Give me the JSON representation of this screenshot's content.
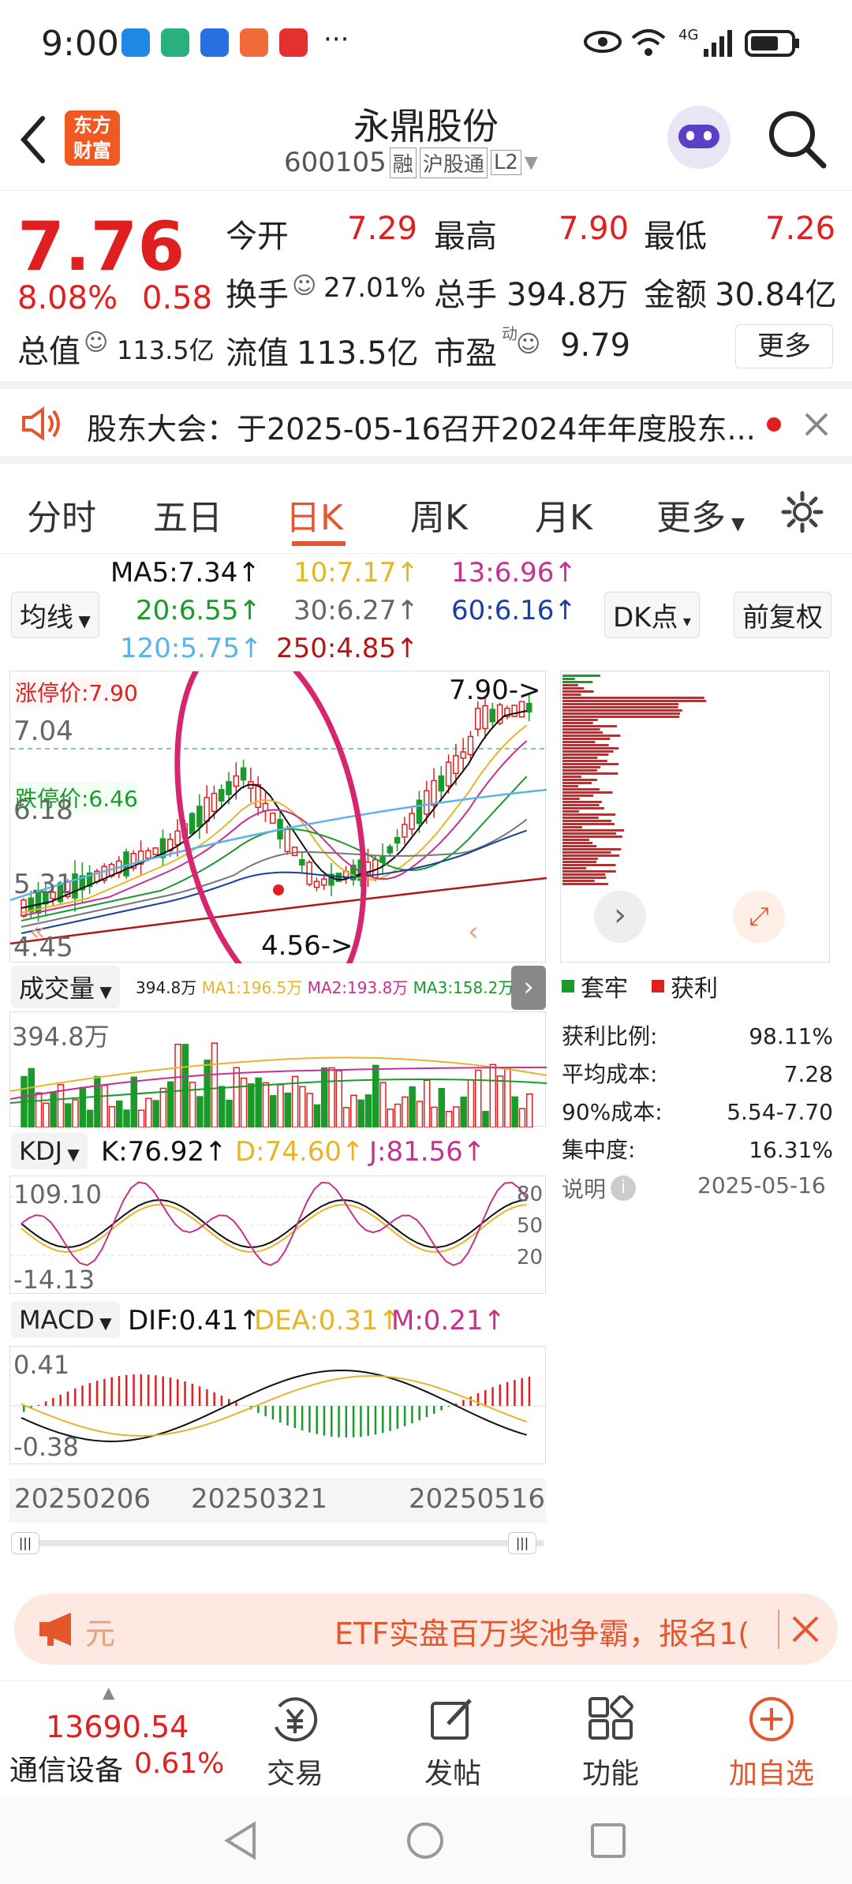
{
  "status": {
    "time": "9:00",
    "more": "···",
    "network": "4G"
  },
  "header": {
    "logo_line1": "东方",
    "logo_line2": "财富",
    "stock_name": "永鼎股份",
    "code": "600105",
    "tag_margin": "融",
    "tag_connect": "沪股通",
    "tag_level": "L2"
  },
  "quote": {
    "price": "7.76",
    "change_pct": "8.08%",
    "change_amt": "0.58",
    "open_label": "今开",
    "open": "7.29",
    "high_label": "最高",
    "high": "7.90",
    "low_label": "最低",
    "low": "7.26",
    "turnover_label": "换手",
    "turnover": "27.01%",
    "volume_label": "总手",
    "volume": "394.8万",
    "amount_label": "金额",
    "amount": "30.84亿",
    "mktcap_label": "总值",
    "mktcap": "113.5亿",
    "float_label": "流值",
    "float": "113.5亿",
    "pe_label": "市盈",
    "pe_sup": "动",
    "pe": "9.79",
    "more_label": "更多"
  },
  "notice": {
    "text": "股东大会：于2025-05-16召开2024年年度股东..."
  },
  "tabs": [
    "分时",
    "五日",
    "日K",
    "周K",
    "月K",
    "更多"
  ],
  "ma": {
    "selector": "均线",
    "ma5": "MA5:7.34↑",
    "ma10": "10:7.17↑",
    "ma13": "13:6.96↑",
    "ma20": "20:6.55↑",
    "ma30": "30:6.27↑",
    "ma60": "60:6.16↑",
    "ma120": "120:5.75↑",
    "ma250": "250:4.85↑",
    "dk_button": "DK点",
    "adjust_button": "前复权"
  },
  "kline": {
    "limit_up": "涨停价:7.90",
    "limit_down": "跌停价:6.46",
    "y_top": "7.04",
    "y_mid": "6.18",
    "y_low1": "5.31",
    "y_low2": "4.45",
    "high_marker": "7.90->",
    "low_marker": "4.56->"
  },
  "volume": {
    "selector": "成交量",
    "vol": "394.8万",
    "ma1": "MA1:196.5万",
    "ma2": "MA2:193.8万",
    "ma3": "MA3:158.2万",
    "y_top": "394.8万"
  },
  "kdj": {
    "selector": "KDJ",
    "k": "K:76.92↑",
    "d": "D:74.60↑",
    "j": "J:81.56↑",
    "y_top": "109.10",
    "y_bot": "-14.13",
    "lv80": "80",
    "lv50": "50",
    "lv20": "20"
  },
  "macd": {
    "selector": "MACD",
    "dif": "DIF:0.41↑",
    "dea": "DEA:0.31↑",
    "m": "M:0.21↑",
    "y_top": "0.41",
    "y_bot": "-0.38"
  },
  "dates": [
    "20250206",
    "20250321",
    "20250516"
  ],
  "chips": {
    "legend_trap": "套牢",
    "legend_profit": "获利",
    "profit_ratio_label": "获利比例:",
    "profit_ratio": "98.11%",
    "avg_cost_label": "平均成本:",
    "avg_cost": "7.28",
    "cost90_label": "90%成本:",
    "cost90": "5.54-7.70",
    "concentration_label": "集中度:",
    "concentration": "16.31%",
    "note_label": "说明",
    "date": "2025-05-16"
  },
  "banner": {
    "prefix": "元",
    "text": "ETF实盘百万奖池争霸，报名1("
  },
  "bottom": {
    "index_value": "13690.54",
    "index_name": "通信设备",
    "index_pct": "0.61%",
    "trade": "交易",
    "post": "发帖",
    "func": "功能",
    "add": "加自选"
  },
  "colors": {
    "up": "#e02020",
    "down": "#1a9a2a",
    "accent": "#e4572e",
    "ma5": "#111111",
    "ma10": "#e6b52a",
    "ma13": "#c8308f",
    "ma20": "#1a9a2a",
    "ma30": "#777777",
    "ma60": "#1a3fa0",
    "ma120": "#5ab4e8",
    "ma250": "#b01818",
    "annotation": "#d6266e"
  }
}
